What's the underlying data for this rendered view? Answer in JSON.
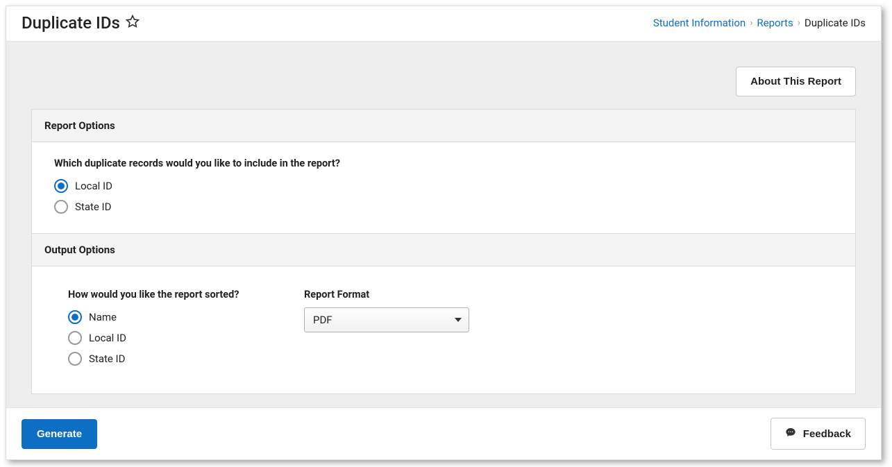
{
  "header": {
    "title": "Duplicate IDs"
  },
  "breadcrumb": {
    "items": [
      "Student Information",
      "Reports",
      "Duplicate IDs"
    ]
  },
  "buttons": {
    "about": "About This Report",
    "generate": "Generate",
    "feedback": "Feedback"
  },
  "sections": {
    "report_options": {
      "title": "Report Options",
      "question": "Which duplicate records would you like to include in the report?",
      "options": [
        {
          "label": "Local ID",
          "selected": true
        },
        {
          "label": "State ID",
          "selected": false
        }
      ]
    },
    "output_options": {
      "title": "Output Options",
      "sort_question": "How would you like the report sorted?",
      "sort_options": [
        {
          "label": "Name",
          "selected": true
        },
        {
          "label": "Local ID",
          "selected": false
        },
        {
          "label": "State ID",
          "selected": false
        }
      ],
      "format_label": "Report Format",
      "format_value": "PDF"
    }
  }
}
